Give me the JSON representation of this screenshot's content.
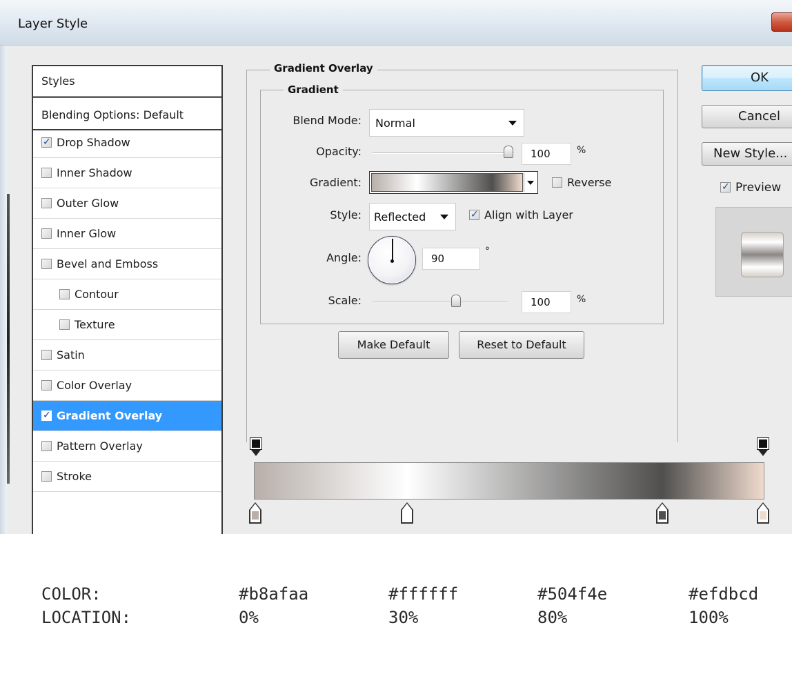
{
  "window": {
    "title": "Layer Style"
  },
  "styles_list": {
    "header": "Styles",
    "blending_options": "Blending Options: Default",
    "items": [
      {
        "label": "Drop Shadow",
        "checked": true,
        "indent": false,
        "selected": false
      },
      {
        "label": "Inner Shadow",
        "checked": false,
        "indent": false,
        "selected": false
      },
      {
        "label": "Outer Glow",
        "checked": false,
        "indent": false,
        "selected": false
      },
      {
        "label": "Inner Glow",
        "checked": false,
        "indent": false,
        "selected": false
      },
      {
        "label": "Bevel and Emboss",
        "checked": false,
        "indent": false,
        "selected": false
      },
      {
        "label": "Contour",
        "checked": false,
        "indent": true,
        "selected": false
      },
      {
        "label": "Texture",
        "checked": false,
        "indent": true,
        "selected": false
      },
      {
        "label": "Satin",
        "checked": false,
        "indent": false,
        "selected": false
      },
      {
        "label": "Color Overlay",
        "checked": false,
        "indent": false,
        "selected": false
      },
      {
        "label": "Gradient Overlay",
        "checked": true,
        "indent": false,
        "selected": true
      },
      {
        "label": "Pattern Overlay",
        "checked": false,
        "indent": false,
        "selected": false
      },
      {
        "label": "Stroke",
        "checked": false,
        "indent": false,
        "selected": false
      }
    ]
  },
  "panel": {
    "section_title": "Gradient Overlay",
    "group_title": "Gradient",
    "blend_mode_label": "Blend Mode:",
    "blend_mode_value": "Normal",
    "opacity_label": "Opacity:",
    "opacity_value": "100",
    "opacity_unit": "%",
    "gradient_label": "Gradient:",
    "reverse_label": "Reverse",
    "reverse_checked": false,
    "style_label": "Style:",
    "style_value": "Reflected",
    "align_label": "Align with Layer",
    "align_checked": true,
    "angle_label": "Angle:",
    "angle_value": "90",
    "angle_unit": "°",
    "scale_label": "Scale:",
    "scale_value": "100",
    "scale_unit": "%",
    "make_default": "Make Default",
    "reset_default": "Reset to Default"
  },
  "buttons": {
    "ok": "OK",
    "cancel": "Cancel",
    "new_style": "New Style...",
    "preview_label": "Preview",
    "preview_checked": true
  },
  "gradient_stops": [
    {
      "color": "#b8afaa",
      "location": "0%"
    },
    {
      "color": "#ffffff",
      "location": "30%"
    },
    {
      "color": "#504f4e",
      "location": "80%"
    },
    {
      "color": "#efdbcd",
      "location": "100%"
    }
  ],
  "legend": {
    "color_label": "COLOR:",
    "location_label": "LOCATION:",
    "colors": [
      "#b8afaa",
      "#ffffff",
      "#504f4e",
      "#efdbcd"
    ],
    "locations": [
      "0%",
      "30%",
      "80%",
      "100%"
    ]
  }
}
